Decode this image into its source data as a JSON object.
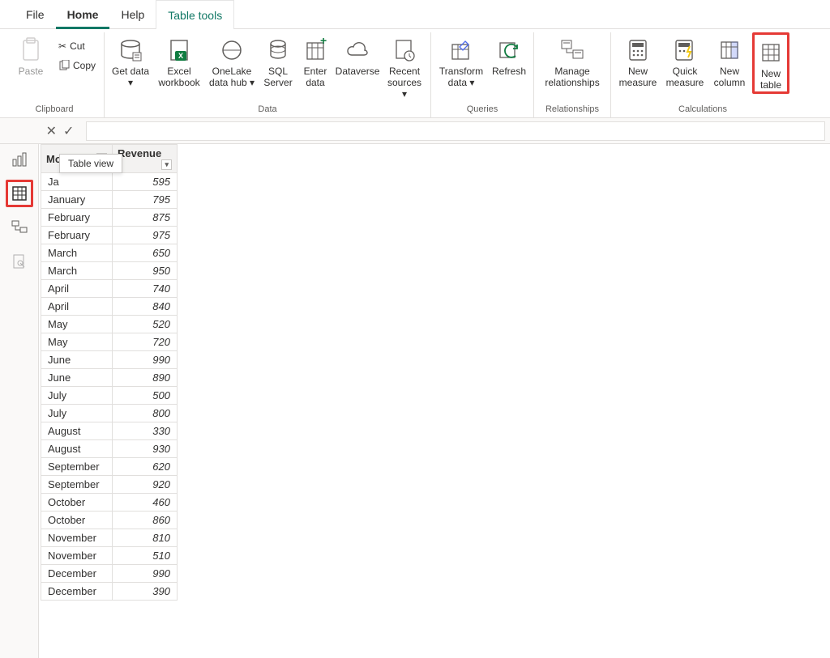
{
  "tabs": {
    "file": "File",
    "home": "Home",
    "help": "Help",
    "table_tools": "Table tools"
  },
  "ribbon": {
    "clipboard": {
      "label": "Clipboard",
      "paste": "Paste",
      "cut": "Cut",
      "copy": "Copy"
    },
    "data": {
      "label": "Data",
      "get_data": "Get data",
      "excel_wb": "Excel workbook",
      "onelake": "OneLake data hub",
      "sql": "SQL Server",
      "enter": "Enter data",
      "dataverse": "Dataverse",
      "recent": "Recent sources"
    },
    "queries": {
      "label": "Queries",
      "transform": "Transform data",
      "refresh": "Refresh"
    },
    "relationships": {
      "label": "Relationships",
      "manage": "Manage relationships"
    },
    "calculations": {
      "label": "Calculations",
      "new_measure": "New measure",
      "quick_measure": "Quick measure",
      "new_column": "New column",
      "new_table": "New table"
    }
  },
  "tooltip": "Table view",
  "table": {
    "columns": [
      "Month",
      "Revenue"
    ],
    "rows": [
      [
        "Ja",
        "595"
      ],
      [
        "January",
        "795"
      ],
      [
        "February",
        "875"
      ],
      [
        "February",
        "975"
      ],
      [
        "March",
        "650"
      ],
      [
        "March",
        "950"
      ],
      [
        "April",
        "740"
      ],
      [
        "April",
        "840"
      ],
      [
        "May",
        "520"
      ],
      [
        "May",
        "720"
      ],
      [
        "June",
        "990"
      ],
      [
        "June",
        "890"
      ],
      [
        "July",
        "500"
      ],
      [
        "July",
        "800"
      ],
      [
        "August",
        "330"
      ],
      [
        "August",
        "930"
      ],
      [
        "September",
        "620"
      ],
      [
        "September",
        "920"
      ],
      [
        "October",
        "460"
      ],
      [
        "October",
        "860"
      ],
      [
        "November",
        "810"
      ],
      [
        "November",
        "510"
      ],
      [
        "December",
        "990"
      ],
      [
        "December",
        "390"
      ]
    ]
  }
}
